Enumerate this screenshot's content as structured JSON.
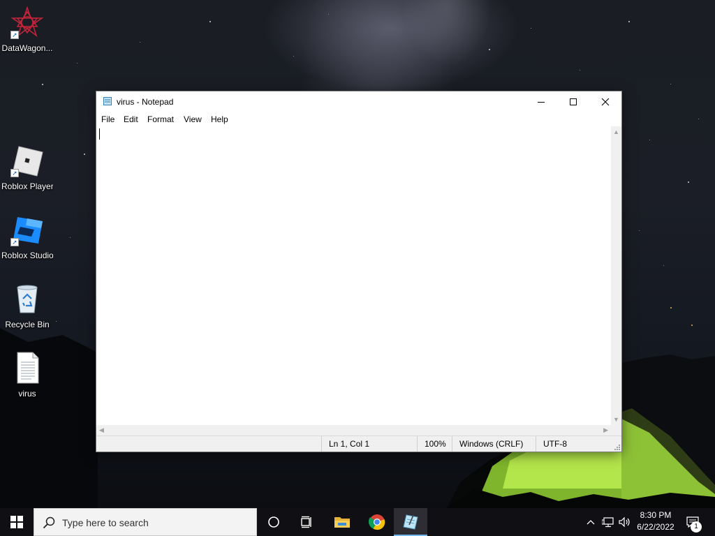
{
  "desktop": {
    "icons": [
      {
        "label": "DataWagon...",
        "icon": "datawagon-app-icon"
      },
      {
        "label": "Roblox Player",
        "icon": "roblox-player-icon"
      },
      {
        "label": "Roblox Studio",
        "icon": "roblox-studio-icon"
      },
      {
        "label": "Recycle Bin",
        "icon": "recycle-bin-icon"
      },
      {
        "label": "virus",
        "icon": "text-file-icon"
      }
    ]
  },
  "notepad": {
    "title": "virus - Notepad",
    "menu": [
      "File",
      "Edit",
      "Format",
      "View",
      "Help"
    ],
    "content": "",
    "status": {
      "position": "Ln 1, Col 1",
      "zoom": "100%",
      "line_ending": "Windows (CRLF)",
      "encoding": "UTF-8"
    }
  },
  "taskbar": {
    "search_placeholder": "Type here to search",
    "pinned": [
      "cortana-icon",
      "task-view-icon",
      "file-explorer-icon",
      "chrome-icon",
      "notepad-icon"
    ],
    "clock_time": "8:30 PM",
    "clock_date": "6/22/2022",
    "notification_count": "1"
  },
  "colors": {
    "accent": "#76b9ed",
    "taskbar": "#101014",
    "tent_green": "#9ed43a"
  }
}
